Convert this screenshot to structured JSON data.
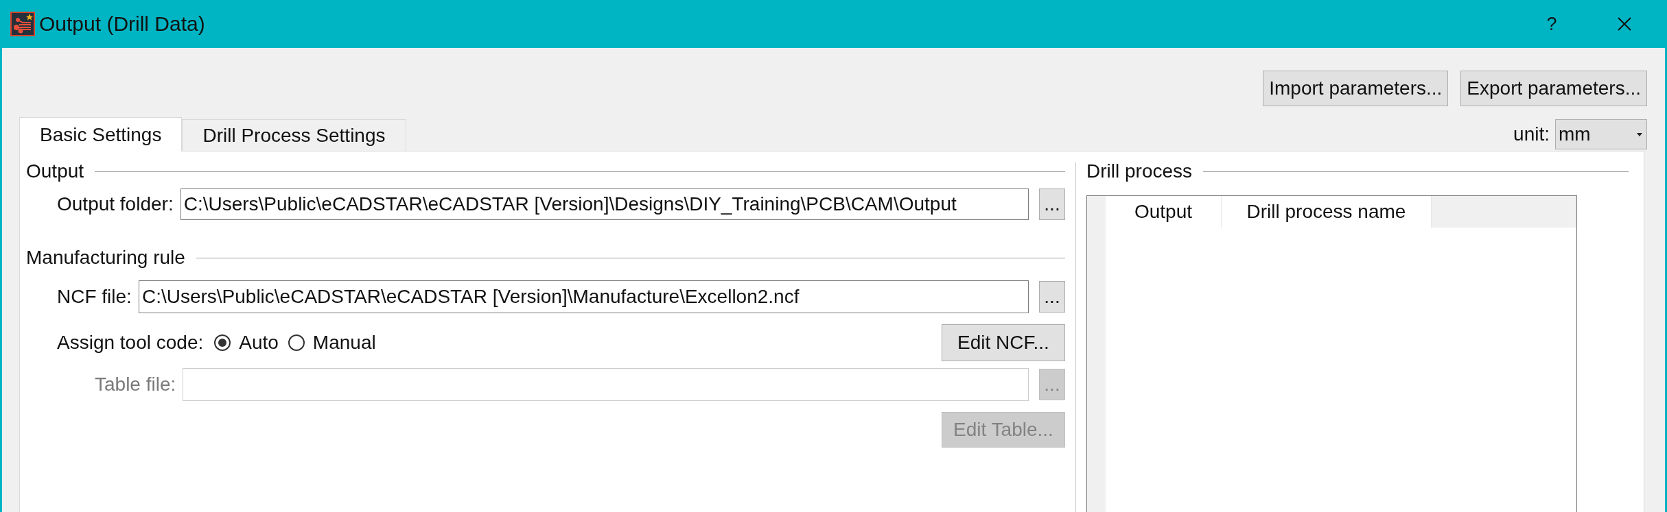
{
  "window": {
    "title": "Output (Drill Data)",
    "help_button": "?"
  },
  "toolbar_buttons": [
    "Import parameters...",
    "Export parameters..."
  ],
  "tabs": [
    {
      "label": "Basic Settings",
      "selected": true
    },
    {
      "label": "Drill Process Settings",
      "selected": false
    }
  ],
  "unit": {
    "label": "unit:",
    "value": "mm"
  },
  "output_section": {
    "title": "Output",
    "output_folder": {
      "label": "Output folder:",
      "value": "C:\\Users\\Public\\eCADSTAR\\eCADSTAR [Version]\\Designs\\DIY_Training\\PCB\\CAM\\Output",
      "browse": "...",
      "disabled": false
    }
  },
  "manufacturing_rule": {
    "title": "Manufacturing rule",
    "ncf_file": {
      "label": "NCF file:",
      "value": "C:\\Users\\Public\\eCADSTAR\\eCADSTAR [Version]\\Manufacture\\Excellon2.ncf",
      "browse": "...",
      "disabled": false
    },
    "assign_tool_code": {
      "label": "Assign tool code:",
      "options": [
        {
          "label": "Auto",
          "selected": true
        },
        {
          "label": "Manual",
          "selected": false
        }
      ]
    },
    "edit_ncf": {
      "label": "Edit NCF...",
      "disabled": false
    },
    "table_file": {
      "label": "Table file:",
      "browse": "...",
      "disabled": true
    },
    "edit_table": {
      "label": "Edit Table...",
      "disabled": true
    }
  },
  "drill_process": {
    "title": "Drill process",
    "columns": [
      "Output",
      "Drill process name"
    ]
  }
}
